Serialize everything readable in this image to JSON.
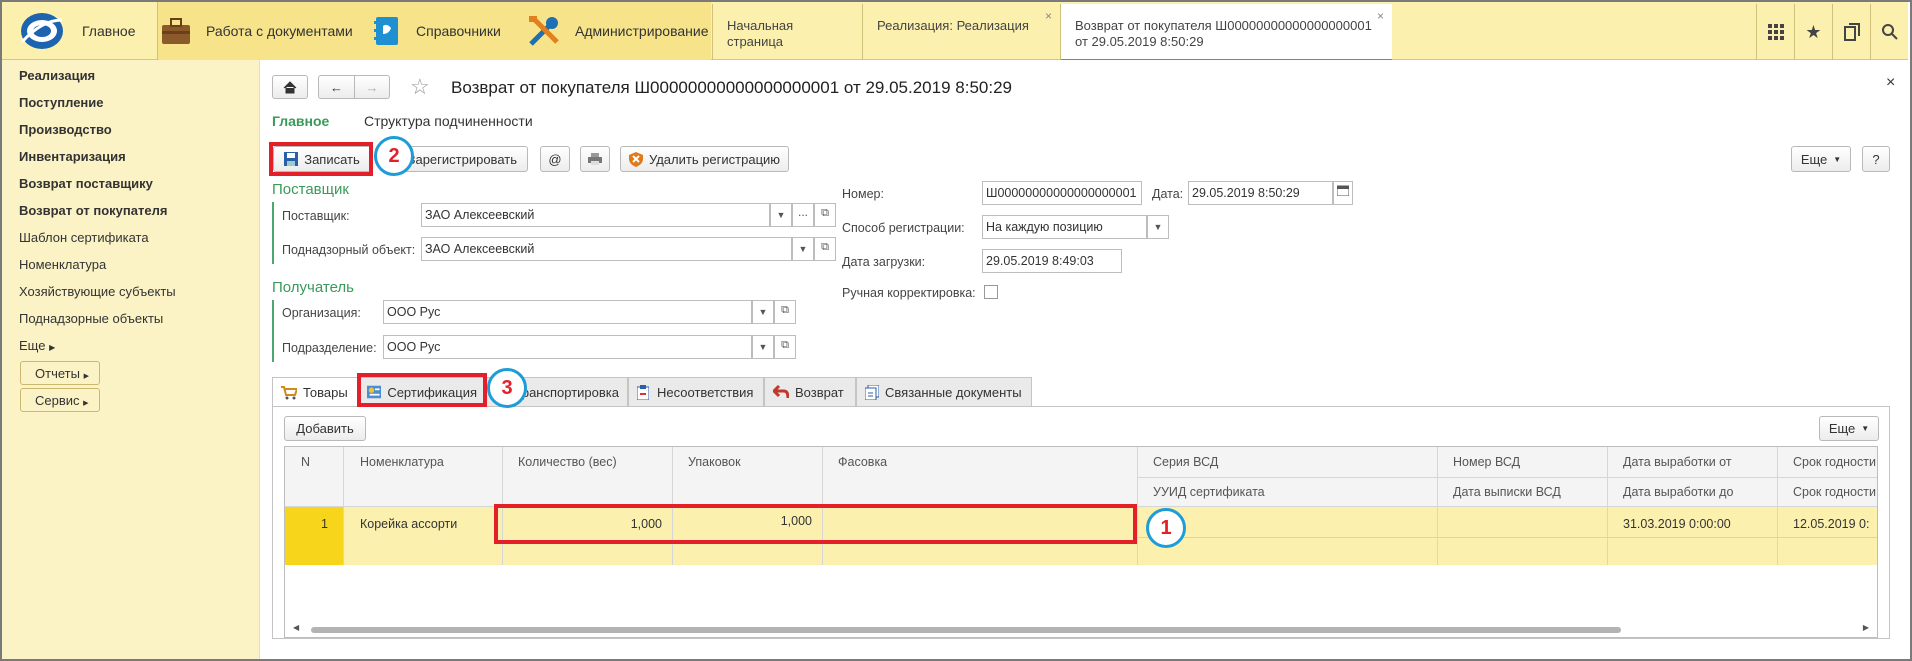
{
  "topbar": {
    "sections": [
      {
        "label": "Главное",
        "icon": "logo-icon"
      },
      {
        "label": "Работа с документами",
        "icon": "briefcase-icon"
      },
      {
        "label": "Справочники",
        "icon": "book-icon"
      },
      {
        "label": "Администрирование",
        "icon": "tools-icon"
      }
    ],
    "open_tabs": [
      {
        "label": "Начальная страница"
      },
      {
        "label": "Реализация: Реализация",
        "close": "×"
      },
      {
        "label_line1": "Возврат от покупателя Ш00000000000000000001",
        "label_line2": "от 29.05.2019 8:50:29",
        "close": "×"
      }
    ],
    "icons": [
      "apps-grid-icon",
      "star-icon",
      "history-icon",
      "search-icon"
    ]
  },
  "sidebar": {
    "items": [
      {
        "label": "Реализация",
        "bold": true
      },
      {
        "label": "Поступление",
        "bold": true
      },
      {
        "label": "Производство",
        "bold": true
      },
      {
        "label": "Инвентаризация",
        "bold": true
      },
      {
        "label": "Возврат поставщику",
        "bold": true
      },
      {
        "label": "Возврат от покупателя",
        "bold": true
      },
      {
        "label": "Шаблон сертификата",
        "bold": false
      },
      {
        "label": "Номенклатура",
        "bold": false
      },
      {
        "label": "Хозяйствующие субъекты",
        "bold": false
      },
      {
        "label": "Поднадзорные объекты",
        "bold": false
      },
      {
        "label": "Еще",
        "bold": false
      }
    ],
    "buttons": [
      "Отчеты",
      "Сервис"
    ]
  },
  "doc": {
    "title": "Возврат от покупателя Ш00000000000000000001 от 29.05.2019 8:50:29",
    "nav_main": "Главное",
    "nav_struct": "Структура подчиненности",
    "close": "×",
    "toolbar": {
      "save": "Записать",
      "register": "Зарегистрировать",
      "at": "@",
      "delete_reg": "Удалить регистрацию",
      "more": "Еще",
      "help": "?"
    },
    "supplier_group": "Поставщик",
    "supplier_label": "Поставщик:",
    "supplier_value": "ЗАО  Алексеевский",
    "object_label": "Поднадзорный объект:",
    "object_value": "ЗАО Алексеевский",
    "recipient_group": "Получатель",
    "org_label": "Организация:",
    "org_value": "ООО Рус",
    "dept_label": "Подразделение:",
    "dept_value": "ООО Рус",
    "number_label": "Номер:",
    "number_value": "Ш00000000000000000001",
    "date_label": "Дата:",
    "date_value": "29.05.2019  8:50:29",
    "regmode_label": "Способ регистрации:",
    "regmode_value": "На каждую позицию",
    "loaddate_label": "Дата загрузки:",
    "loaddate_value": "29.05.2019  8:49:03",
    "manual_label": "Ручная корректировка:"
  },
  "tabs": [
    "Товары",
    "Сертификация",
    "Транспортировка",
    "Несоответствия",
    "Возврат",
    "Связанные документы"
  ],
  "table": {
    "add": "Добавить",
    "more": "Еще",
    "headers_top": [
      "N",
      "Номенклатура",
      "Количество (вес)",
      "Упаковок",
      "Фасовка",
      "Серия ВСД",
      "Номер ВСД",
      "Дата выработки от",
      "Срок годности"
    ],
    "headers_bottom": [
      "УУИД сертификата",
      "Дата выписки ВСД",
      "Дата выработки до",
      "Срок годности"
    ],
    "rows": [
      {
        "n": "1",
        "name": "Корейка ассорти",
        "qty": "1,000",
        "packs": "1,000",
        "prod_from": "31.03.2019 0:00:00",
        "expiry": "12.05.2019 0:"
      }
    ]
  },
  "annotations": [
    "1",
    "2",
    "3"
  ]
}
